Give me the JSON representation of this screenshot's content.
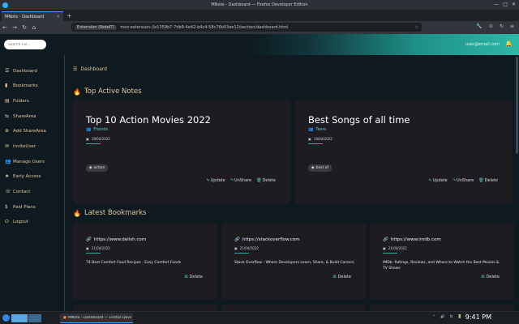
{
  "window": {
    "title": "MNote - Dashboard — Firefox Developer Edition",
    "controls": [
      "—",
      "□",
      "✕"
    ]
  },
  "browser": {
    "tab_title": "MNote - Dashboard",
    "tab_close": "×",
    "new_tab": "+",
    "nav": [
      "←",
      "→",
      "↻",
      "⌂"
    ],
    "url_prefix": "Extension (NoteIT)",
    "url": "moz-extension://e1359b7-7db9-4e42-b4c4-58c76b03ee12/section/dashboard.html",
    "url_star": "☆",
    "right_icons": [
      "🔧",
      "⊙",
      "↻",
      "≡"
    ]
  },
  "header": {
    "search_placeholder": "Search Fol...",
    "user_email": "user@email.com",
    "bell": "🔔"
  },
  "sidebar": {
    "items": [
      {
        "icon": "☰",
        "label": "Dashboard"
      },
      {
        "icon": "▮",
        "label": "Bookmarks"
      },
      {
        "icon": "▤",
        "label": "Folders"
      },
      {
        "icon": "⇆",
        "label": "ShareArea"
      },
      {
        "icon": "⊕",
        "label": "Add ShareArea"
      },
      {
        "icon": "✉",
        "label": "InviteUser"
      },
      {
        "icon": "👥",
        "label": "Manage Users"
      },
      {
        "icon": "★",
        "label": "Early Access"
      },
      {
        "icon": "☏",
        "label": "Contact"
      },
      {
        "icon": "$",
        "label": "Paid Plans"
      },
      {
        "icon": "⏻",
        "label": "Logout"
      }
    ]
  },
  "breadcrumb": {
    "icon": "☰",
    "label": "Dashboard"
  },
  "sections": {
    "notes_title": "Top Active Notes",
    "bookmarks_title": "Latest Bookmarks",
    "fire_icon": "🔥"
  },
  "notes": [
    {
      "title": "Top 10 Action Movies 2022",
      "group": "Friends",
      "date": "18/04/2022",
      "tag": "action",
      "actions": {
        "update": "Update",
        "unshare": "UnShare",
        "delete": "Delete"
      }
    },
    {
      "title": "Best Songs of all time",
      "group": "Team",
      "date": "18/04/2022",
      "tag": "best of",
      "actions": {
        "update": "Update",
        "unshare": "UnShare",
        "delete": "Delete"
      }
    }
  ],
  "bookmarks": [
    {
      "url": "https://www.delish.com",
      "date": "21/04/2022",
      "description": "74 Best Comfort Food Recipes - Easy Comfort Foods",
      "delete": "Delete"
    },
    {
      "url": "https://stackoverflow.com",
      "date": "21/04/2022",
      "description": "Stack Overflow - Where Developers Learn, Share, & Build Careers",
      "delete": "Delete"
    },
    {
      "url": "https://www.imdb.com",
      "date": "21/04/2022",
      "description": "IMDb: Ratings, Reviews, and Where to Watch the Best Movies & TV Shows",
      "delete": "Delete"
    }
  ],
  "taskbar": {
    "active_window": "MNote - Dashboard — Firefox Developer Edition",
    "tray": [
      "⌃",
      "🔊",
      "⇅",
      "🔋"
    ],
    "time": "9:41 PM"
  }
}
